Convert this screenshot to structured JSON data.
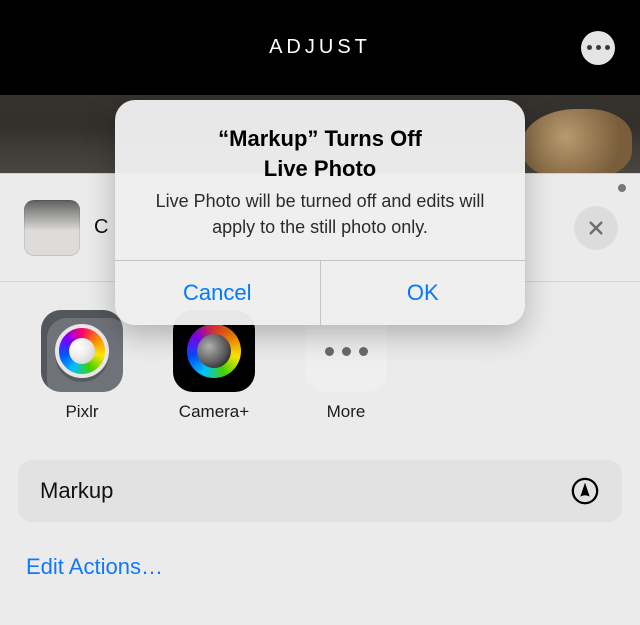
{
  "navbar": {
    "title": "ADJUST"
  },
  "sheet": {
    "header_title": "C",
    "apps": [
      {
        "label": "Pixlr"
      },
      {
        "label": "Camera+"
      },
      {
        "label": "More"
      }
    ],
    "markup_label": "Markup",
    "edit_actions_label": "Edit Actions…"
  },
  "alert": {
    "title": "“Markup” Turns Off\nLive Photo",
    "message": "Live Photo will be turned off and edits will apply to the still photo only.",
    "cancel": "Cancel",
    "ok": "OK"
  }
}
